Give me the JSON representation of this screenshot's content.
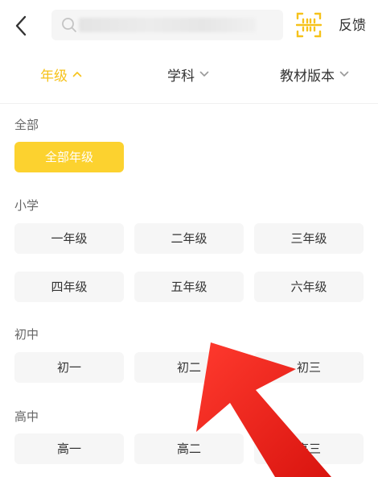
{
  "header": {
    "search": {
      "placeholder": ""
    },
    "feedback_label": "反馈"
  },
  "filters": {
    "grade_label": "年级",
    "subject_label": "学科",
    "textbook_label": "教材版本"
  },
  "sections": {
    "all": {
      "title": "全部",
      "items": [
        "全部年级"
      ]
    },
    "primary": {
      "title": "小学",
      "items": [
        "一年级",
        "二年级",
        "三年级",
        "四年级",
        "五年级",
        "六年级"
      ]
    },
    "junior": {
      "title": "初中",
      "items": [
        "初一",
        "初二",
        "初三"
      ]
    },
    "senior": {
      "title": "高中",
      "items": [
        "高一",
        "高二",
        "高三"
      ]
    }
  },
  "colors": {
    "accent": "#fcd22f",
    "accent_text": "#f6c21a",
    "button_bg": "#f6f6f6",
    "annotation_arrow": "#e8201c"
  },
  "icons": {
    "back": "chevron-left-icon",
    "search": "search-icon",
    "scan": "scan-icon"
  }
}
